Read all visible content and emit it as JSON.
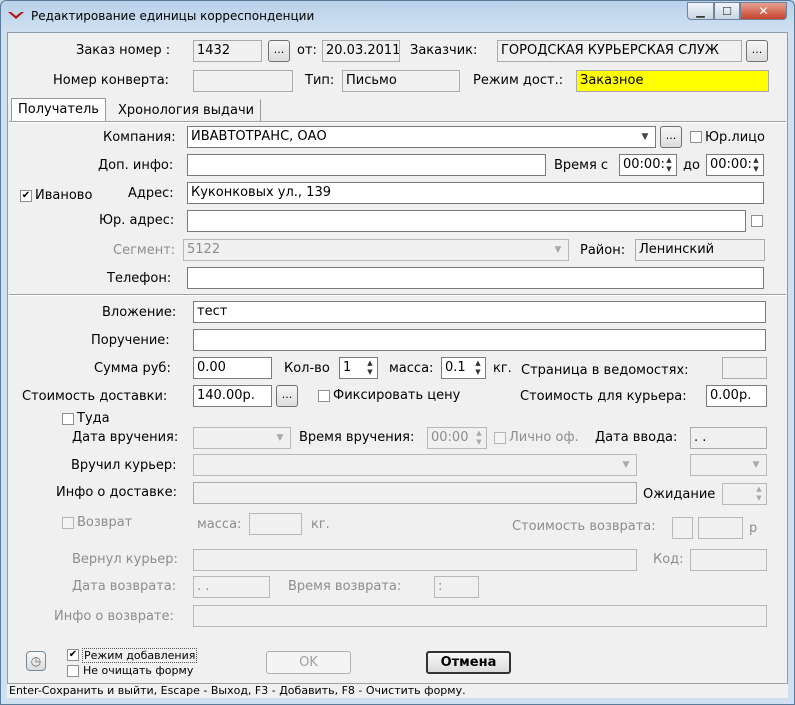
{
  "window": {
    "title": "Редактирование единицы корреспонденции"
  },
  "header": {
    "order_label": "Заказ номер :",
    "order_value": "1432",
    "from_label": "от:",
    "from_value": "20.03.2011",
    "customer_label": "Заказчик:",
    "customer_value": "ГОРОДСКАЯ КУРЬЕРСКАЯ СЛУЖ",
    "envelope_label": "Номер конверта:",
    "envelope_value": "",
    "type_label": "Тип:",
    "type_value": "Письмо",
    "mode_label": "Режим дост.:",
    "mode_value": "Заказное",
    "mode_color": "#ffff00"
  },
  "tabs": [
    {
      "label": "Получатель",
      "active": true
    },
    {
      "label": "Хронология выдачи",
      "active": false
    }
  ],
  "recipient": {
    "company_label": "Компания:",
    "company_value": "ИВАВТОТРАНС, ОАО",
    "legal_label": "Юр.лицо",
    "extra_label": "Доп. инфо:",
    "extra_value": "",
    "time_from_label": "Время с",
    "time_from_value": "00:00:",
    "time_to_label": "до",
    "time_to_value": "00:00:",
    "city_label": "Иваново",
    "address_label": "Адрес:",
    "address_value": "Куконковых ул., 139",
    "legal_address_label": "Юр. адрес:",
    "legal_address_value": "",
    "segment_label": "Сегмент:",
    "segment_value": "5122",
    "district_label": "Район:",
    "district_value": "Ленинский",
    "phone_label": "Телефон:",
    "phone_value": ""
  },
  "details": {
    "attachment_label": "Вложение:",
    "attachment_value": "тест",
    "assignment_label": "Поручение:",
    "assignment_value": "",
    "sum_label": "Сумма руб:",
    "sum_value": "0.00",
    "qty_label": "Кол-во",
    "qty_value": "1",
    "mass_label": "масса:",
    "mass_value": "0.1",
    "kg_label": "кг.",
    "page_label": "Страница в ведомостях:",
    "page_value": "",
    "cost_label": "Стоимость доставки:",
    "cost_value": "140.00р.",
    "fix_price_label": "Фиксировать цену",
    "courier_cost_label": "Стоимость для курьера:",
    "courier_cost_value": "0.00р."
  },
  "delivery": {
    "there_label": "Туда",
    "date_label": "Дата вручения:",
    "date_value": "",
    "time_label": "Время вручения:",
    "time_value": "00:00",
    "personal_label": "Лично оф.",
    "entry_date_label": "Дата ввода:",
    "entry_date_value": " .  .",
    "courier_label": "Вручил курьер:",
    "courier_value": "",
    "info_label": "Инфо о доставке:",
    "info_value": "",
    "wait_label": "Ожидание",
    "wait_value": ""
  },
  "return": {
    "return_label": "Возврат",
    "mass_label": "масса:",
    "mass_value": "",
    "kg_label": "кг.",
    "cost_label": "Стоимость возврата:",
    "cost_value": "",
    "currency": "р",
    "courier_label": "Вернул курьер:",
    "courier_value": "",
    "code_label": "Код:",
    "code_value": "",
    "date_label": "Дата возврата:",
    "date_value": " .  .",
    "time_label": "Время возврата:",
    "time_value": " :",
    "info_label": "Инфо о возврате:",
    "info_value": ""
  },
  "footer": {
    "add_mode_label": "Режим добавления",
    "no_clear_label": "Не очищать форму",
    "ok_label": "OK",
    "cancel_label": "Отмена"
  },
  "status_bar": "Enter-Сохранить и выйти, Escape - Выход, F3 - Добавить, F8 - Очистить форму."
}
